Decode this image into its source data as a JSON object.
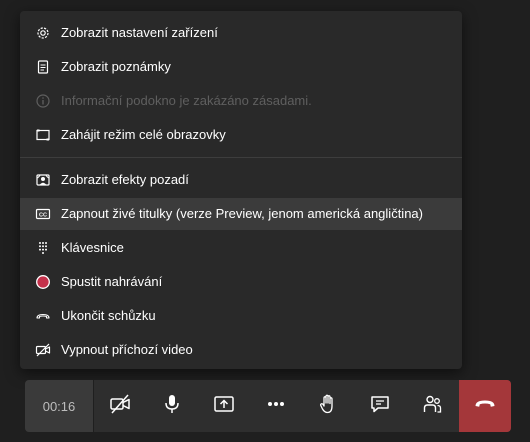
{
  "menu": {
    "items": [
      {
        "label": "Zobrazit nastavení zařízení",
        "icon": "gear-icon"
      },
      {
        "label": "Zobrazit poznámky",
        "icon": "notes-icon"
      },
      {
        "label": "Informační podokno je zakázáno zásadami.",
        "icon": "info-icon",
        "disabled": true
      },
      {
        "label": "Zahájit režim celé obrazovky",
        "icon": "fullscreen-icon"
      },
      {
        "label": "Zobrazit efekty pozadí",
        "icon": "background-effects-icon"
      },
      {
        "label": "Zapnout živé titulky (verze Preview, jenom americká angličtina)",
        "icon": "closed-captions-icon",
        "highlighted": true
      },
      {
        "label": "Klávesnice",
        "icon": "keypad-icon"
      },
      {
        "label": "Spustit nahrávání",
        "icon": "record-icon"
      },
      {
        "label": "Ukončit schůzku",
        "icon": "end-meeting-icon"
      },
      {
        "label": "Vypnout příchozí video",
        "icon": "incoming-video-off-icon"
      }
    ]
  },
  "toolbar": {
    "timer": "00:16",
    "buttons": [
      {
        "icon": "camera-off-icon"
      },
      {
        "icon": "microphone-icon"
      },
      {
        "icon": "share-screen-icon"
      },
      {
        "icon": "more-actions-icon"
      },
      {
        "icon": "raise-hand-icon"
      },
      {
        "icon": "chat-icon"
      },
      {
        "icon": "participants-icon"
      },
      {
        "icon": "hang-up-icon"
      }
    ]
  },
  "colors": {
    "menu_bg": "#292929",
    "highlight_bg": "#3b3b3b",
    "disabled_text": "#5f5f5f",
    "record_red": "#c4314b",
    "hangup_red": "#a4373a"
  }
}
